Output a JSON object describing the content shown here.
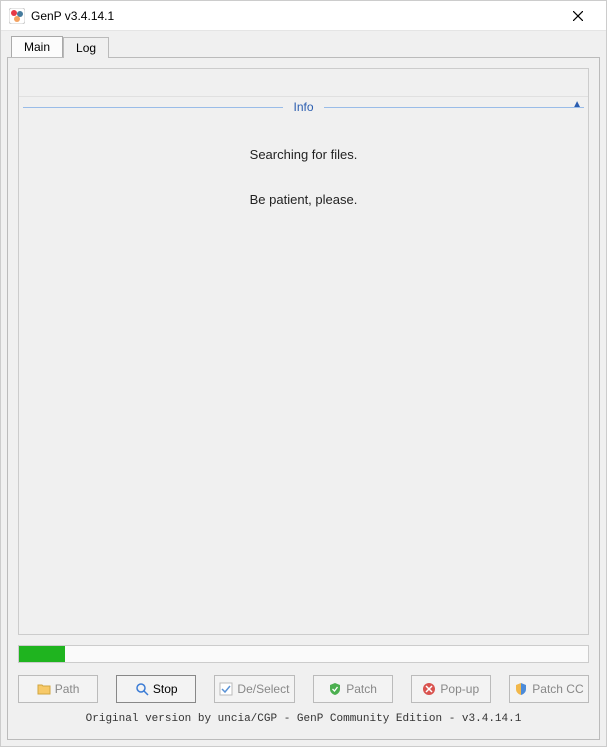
{
  "window": {
    "title": "GenP v3.4.14.1"
  },
  "tabs": {
    "main": "Main",
    "log": "Log"
  },
  "info": {
    "heading": "Info",
    "line1": "Searching for files.",
    "line2": "Be patient, please."
  },
  "progress": {
    "percent": 8
  },
  "buttons": {
    "path": "Path",
    "stop": "Stop",
    "deselect": "De/Select",
    "patch": "Patch",
    "popup": "Pop-up",
    "patchcc": "Patch CC"
  },
  "footer": "Original version by uncia/CGP - GenP Community Edition - v3.4.14.1"
}
